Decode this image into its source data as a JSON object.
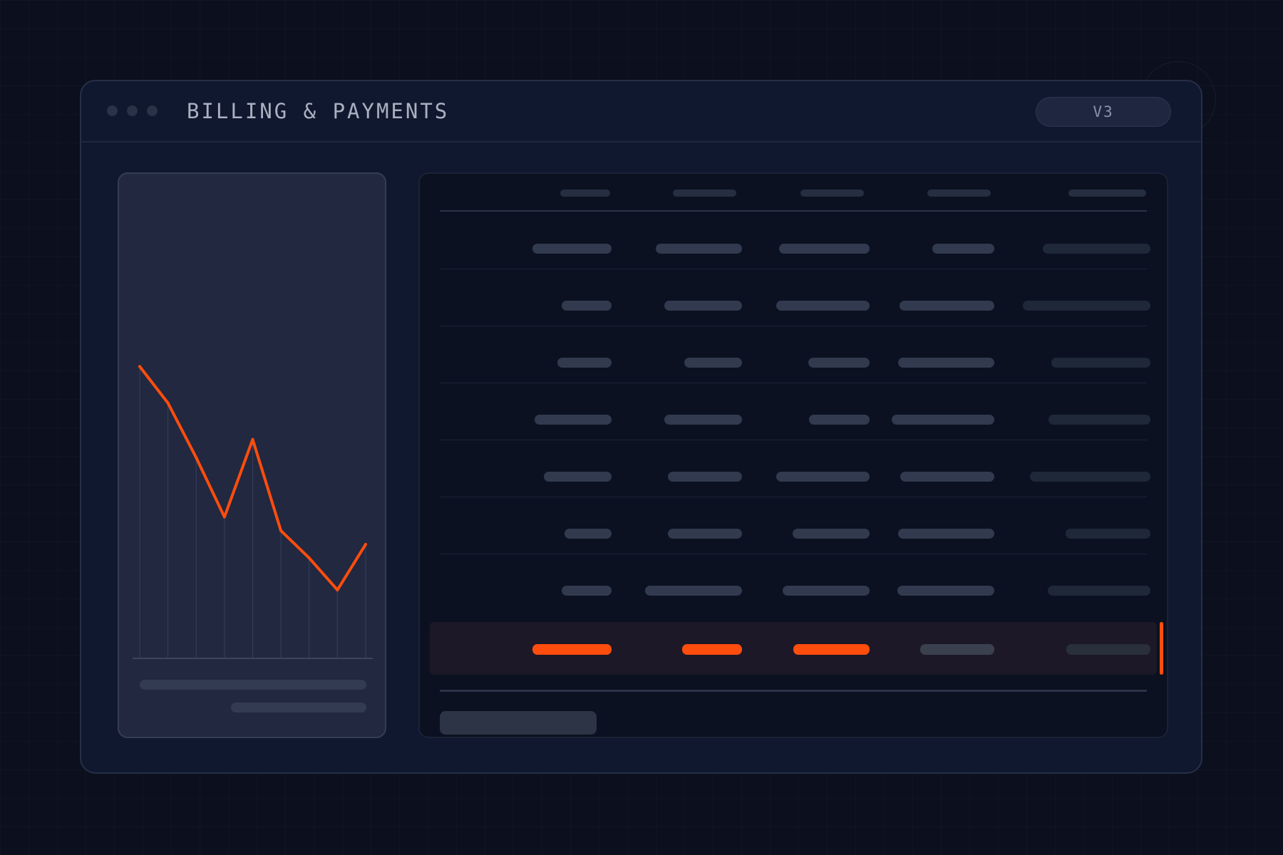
{
  "window": {
    "title": "BILLING & PAYMENTS",
    "version": "V3"
  },
  "colors": {
    "background": "#0b0f1e",
    "window": "#101830",
    "accent": "#ff4d0d",
    "placeholder": "#313a4e"
  },
  "chart_data": {
    "type": "line",
    "x": [
      1,
      2,
      3,
      4,
      5,
      6,
      7,
      8,
      9
    ],
    "values": [
      0.64,
      0.56,
      0.44,
      0.31,
      0.48,
      0.28,
      0.22,
      0.15,
      0.25
    ],
    "ylim": [
      0,
      1
    ],
    "grid": true,
    "line_color": "#ff4d0d"
  },
  "table": {
    "columns": 5,
    "rows": 8,
    "highlighted_row": 8
  }
}
